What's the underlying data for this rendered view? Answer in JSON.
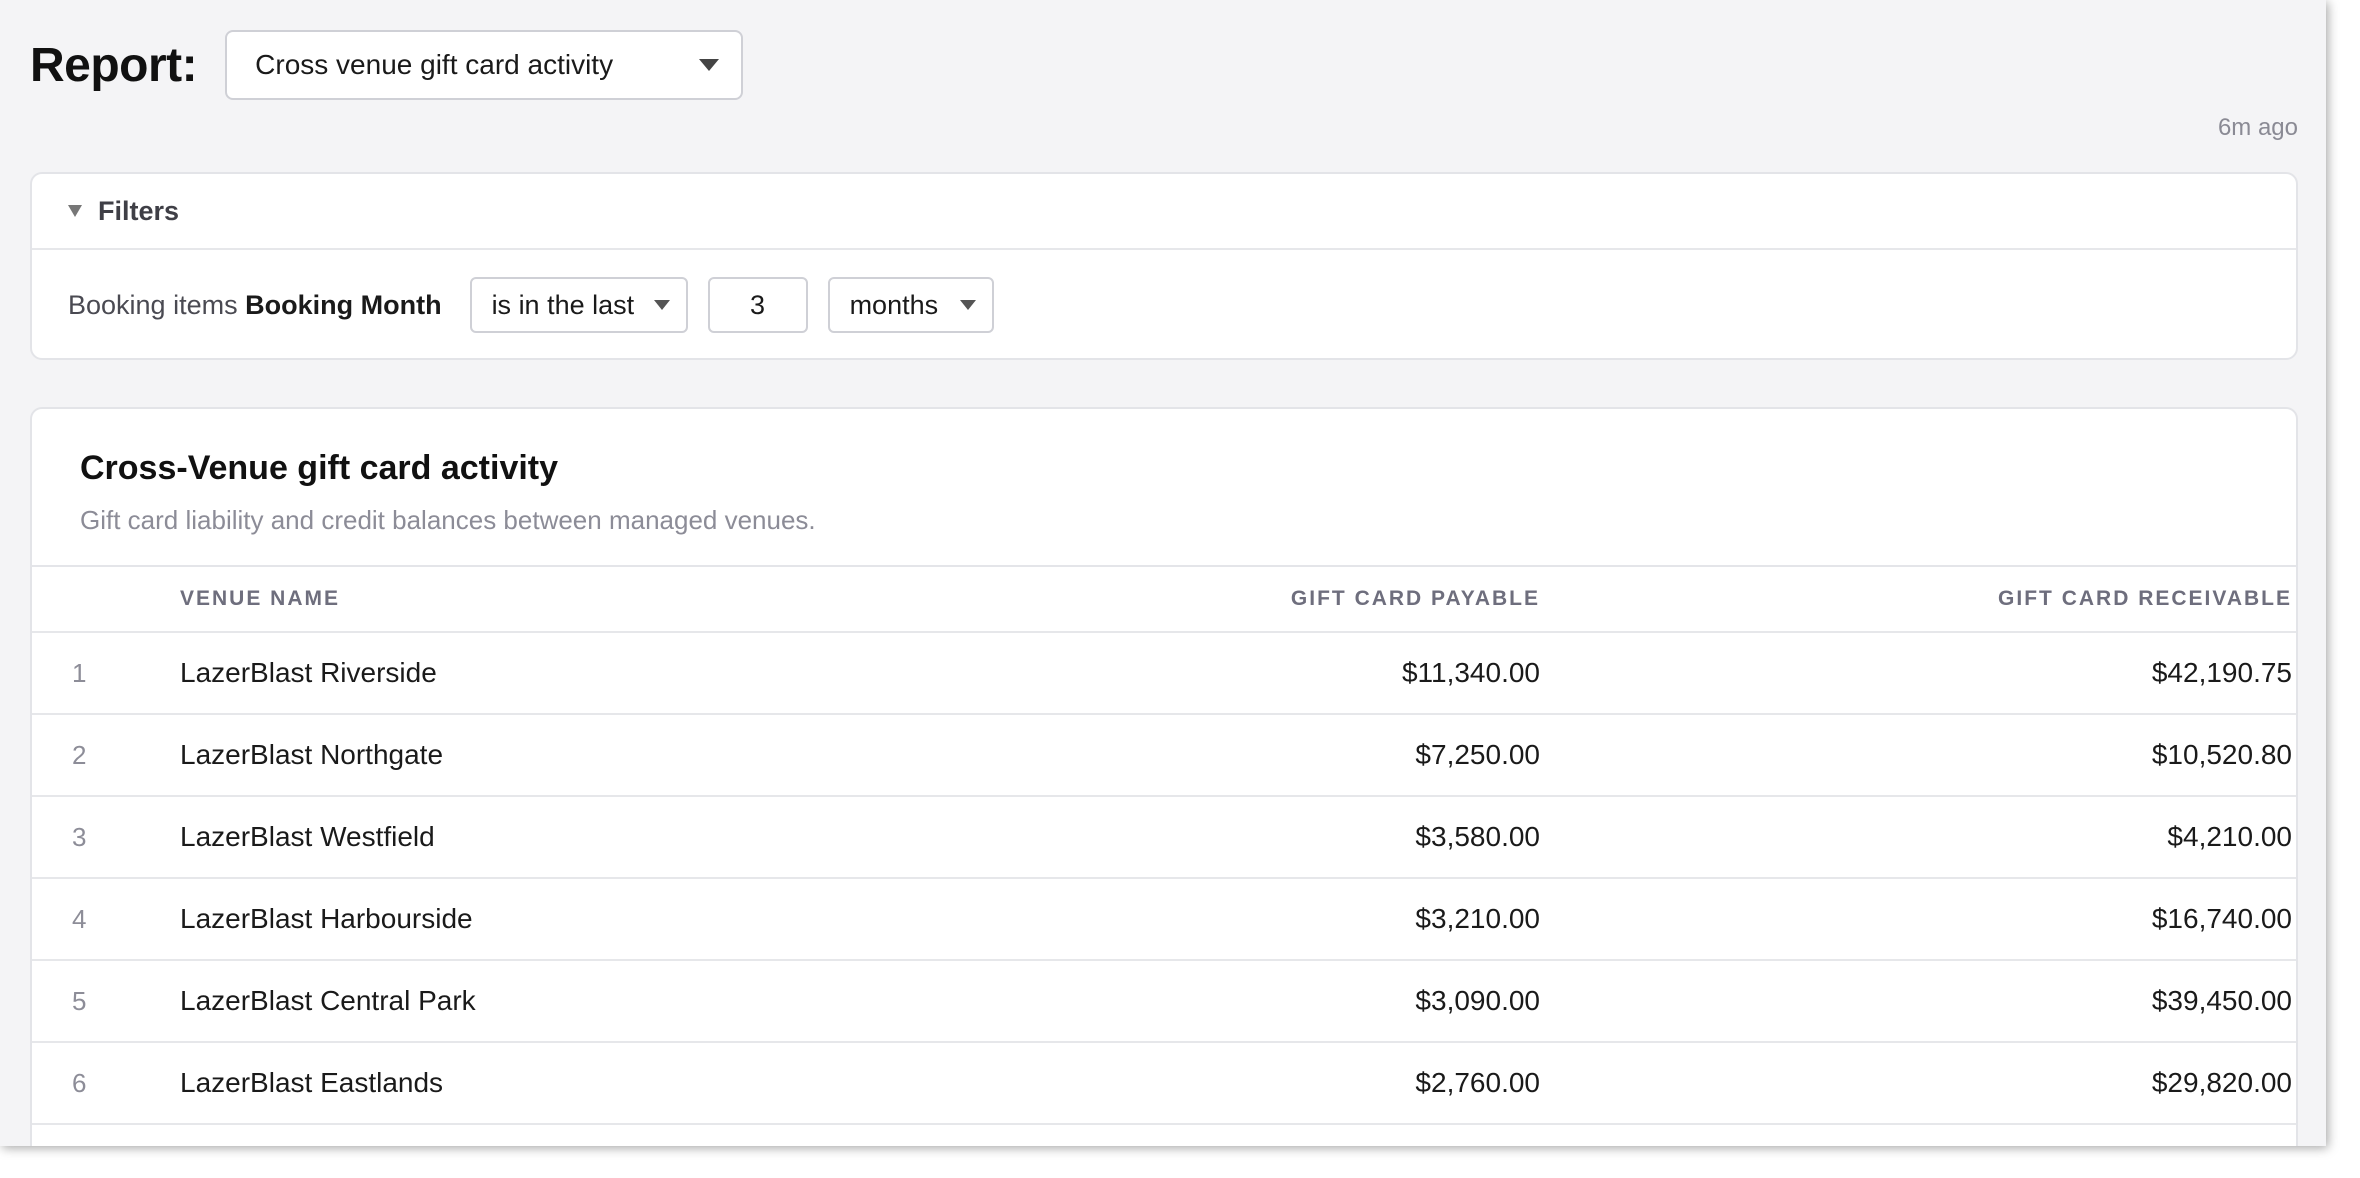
{
  "report": {
    "label": "Report:",
    "selected": "Cross venue gift card activity"
  },
  "updated": "6m ago",
  "filters": {
    "title": "Filters",
    "field_prefix": "Booking items",
    "field_name": "Booking Month",
    "operator": "is in the last",
    "value": "3",
    "unit": "months"
  },
  "table": {
    "title": "Cross-Venue gift card activity",
    "subtitle": "Gift card liability and credit balances between managed venues.",
    "columns": [
      "VENUE NAME",
      "GIFT CARD PAYABLE",
      "GIFT CARD RECEIVABLE"
    ],
    "rows": [
      {
        "index": "1",
        "venue": "LazerBlast Riverside",
        "payable": "$11,340.00",
        "receivable": "$42,190.75"
      },
      {
        "index": "2",
        "venue": "LazerBlast Northgate",
        "payable": "$7,250.00",
        "receivable": "$10,520.80"
      },
      {
        "index": "3",
        "venue": "LazerBlast Westfield",
        "payable": "$3,580.00",
        "receivable": "$4,210.00"
      },
      {
        "index": "4",
        "venue": "LazerBlast Harbourside",
        "payable": "$3,210.00",
        "receivable": "$16,740.00"
      },
      {
        "index": "5",
        "venue": "LazerBlast Central Park",
        "payable": "$3,090.00",
        "receivable": "$39,450.00"
      },
      {
        "index": "6",
        "venue": "LazerBlast Eastlands",
        "payable": "$2,760.00",
        "receivable": "$29,820.00"
      }
    ]
  }
}
